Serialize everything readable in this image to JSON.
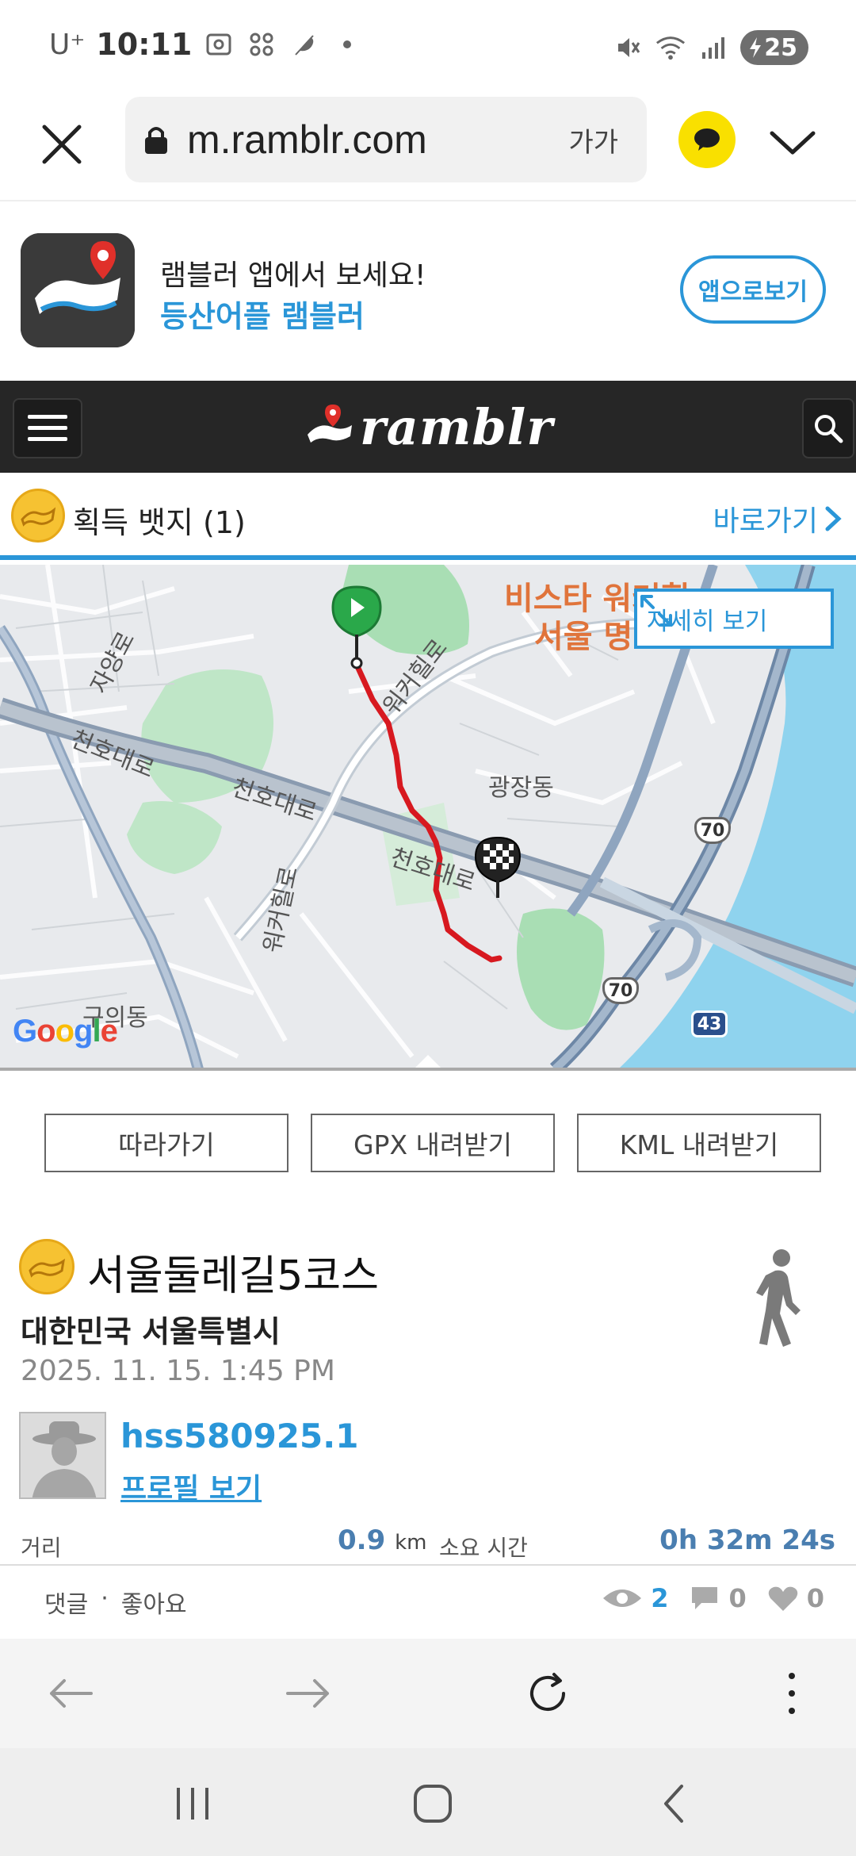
{
  "status_bar": {
    "carrier": "U⁺",
    "time": "10:11",
    "battery": "25"
  },
  "browser": {
    "url": "m.ramblr.com",
    "text_size_label": "가가"
  },
  "promo": {
    "line1": "램블러 앱에서 보세요!",
    "line2": "등산어플 램블러",
    "button": "앱으로보기"
  },
  "site": {
    "logo_text": "ramblr"
  },
  "badge": {
    "label": "획득 뱃지 (1)",
    "link": "바로가기"
  },
  "map": {
    "detail_button": "자세히 보기",
    "labels": {
      "jayangro": "자양로",
      "cheonho_left": "천호대로",
      "cheonho_mid": "천호대로",
      "cheonho_right": "천호대로",
      "walkerhill_top": "워커힐로",
      "walkerhill_bottom": "워커힐로",
      "gwangjang": "광장동",
      "guui": "구의동",
      "poi_line1": "비스타 워커힐",
      "poi_line2": "서울 명",
      "route_70_a": "70",
      "route_70_b": "70",
      "route_43": "43",
      "google": "Google"
    }
  },
  "actions": {
    "follow": "따라가기",
    "gpx": "GPX 내려받기",
    "kml": "KML 내려받기"
  },
  "trip": {
    "title": "서울둘레길5코스",
    "location": "대한민국 서울특별시",
    "date": "2025. 11. 15. 1:45 PM",
    "username": "hss580925.1",
    "profile_link": "프로필 보기",
    "distance_label": "거리",
    "distance_value": "0.9",
    "distance_unit": "km",
    "duration_label": "소요 시간",
    "duration_value": "0h 32m 24s"
  },
  "social": {
    "comments_label": "댓글",
    "separator": "·",
    "likes_label": "좋아요",
    "views": "2",
    "comments_count": "0",
    "likes_count": "0"
  },
  "colors": {
    "accent": "#2a96d8",
    "header_bg": "#262626",
    "route": "#d71920",
    "water": "#8fd3ee"
  }
}
